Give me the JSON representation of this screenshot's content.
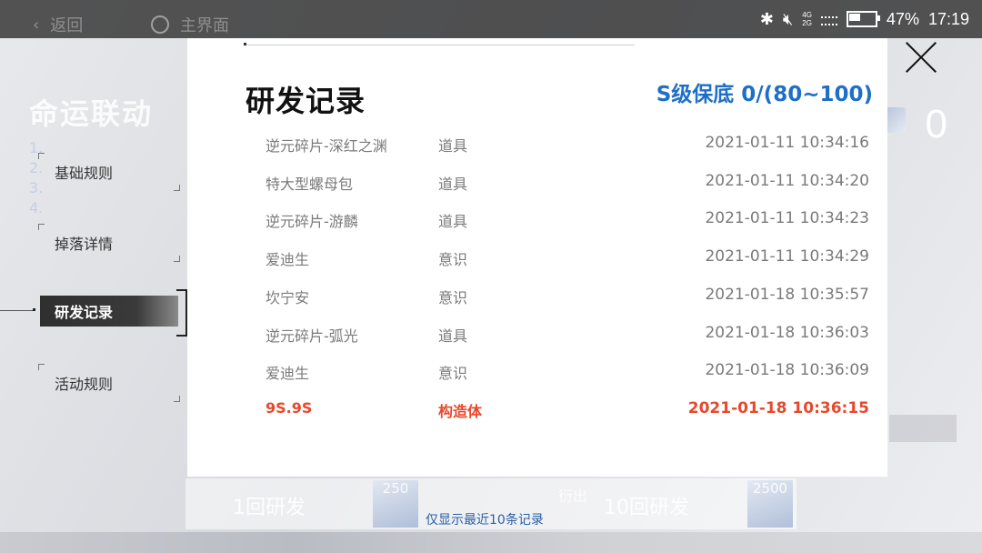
{
  "status_bar": {
    "net_top": "4G",
    "net_bottom": "2G",
    "battery_text": "47%",
    "battery_level": 0.47,
    "time": "17:19"
  },
  "background": {
    "back_label": "返回",
    "home_label": "主界面",
    "event_title": "命运联动",
    "lines": [
      "1.",
      "2.",
      "3.",
      "4."
    ],
    "counter": "0",
    "single_pull": "1回研发",
    "single_cost": "250",
    "ten_pull": "10回研发",
    "ten_cost": "2500",
    "mid_text": "衍出"
  },
  "tabs": [
    {
      "label": "基础规则",
      "active": false
    },
    {
      "label": "掉落详情",
      "active": false
    },
    {
      "label": "研发记录",
      "active": true
    },
    {
      "label": "活动规则",
      "active": false
    }
  ],
  "panel": {
    "title": "研发记录",
    "pity_text": "S级保底 0/(80~100)",
    "footnote": "仅显示最近10条记录",
    "records": [
      {
        "name": "逆元碎片-深红之渊",
        "type": "道具",
        "time": "2021-01-11 10:34:16",
        "highlight": false
      },
      {
        "name": "特大型螺母包",
        "type": "道具",
        "time": "2021-01-11 10:34:20",
        "highlight": false
      },
      {
        "name": "逆元碎片-游麟",
        "type": "道具",
        "time": "2021-01-11 10:34:23",
        "highlight": false
      },
      {
        "name": "爱迪生",
        "type": "意识",
        "time": "2021-01-11 10:34:29",
        "highlight": false
      },
      {
        "name": "坎宁安",
        "type": "意识",
        "time": "2021-01-18 10:35:57",
        "highlight": false
      },
      {
        "name": "逆元碎片-弧光",
        "type": "道具",
        "time": "2021-01-18 10:36:03",
        "highlight": false
      },
      {
        "name": "爱迪生",
        "type": "意识",
        "time": "2021-01-18 10:36:09",
        "highlight": false
      },
      {
        "name": "9S.9S",
        "type": "构造体",
        "time": "2021-01-18 10:36:15",
        "highlight": true
      }
    ]
  },
  "colors": {
    "pity_blue": "#1e6fc8",
    "highlight_red": "#e8482c",
    "footnote_blue": "#2a5fa8"
  }
}
